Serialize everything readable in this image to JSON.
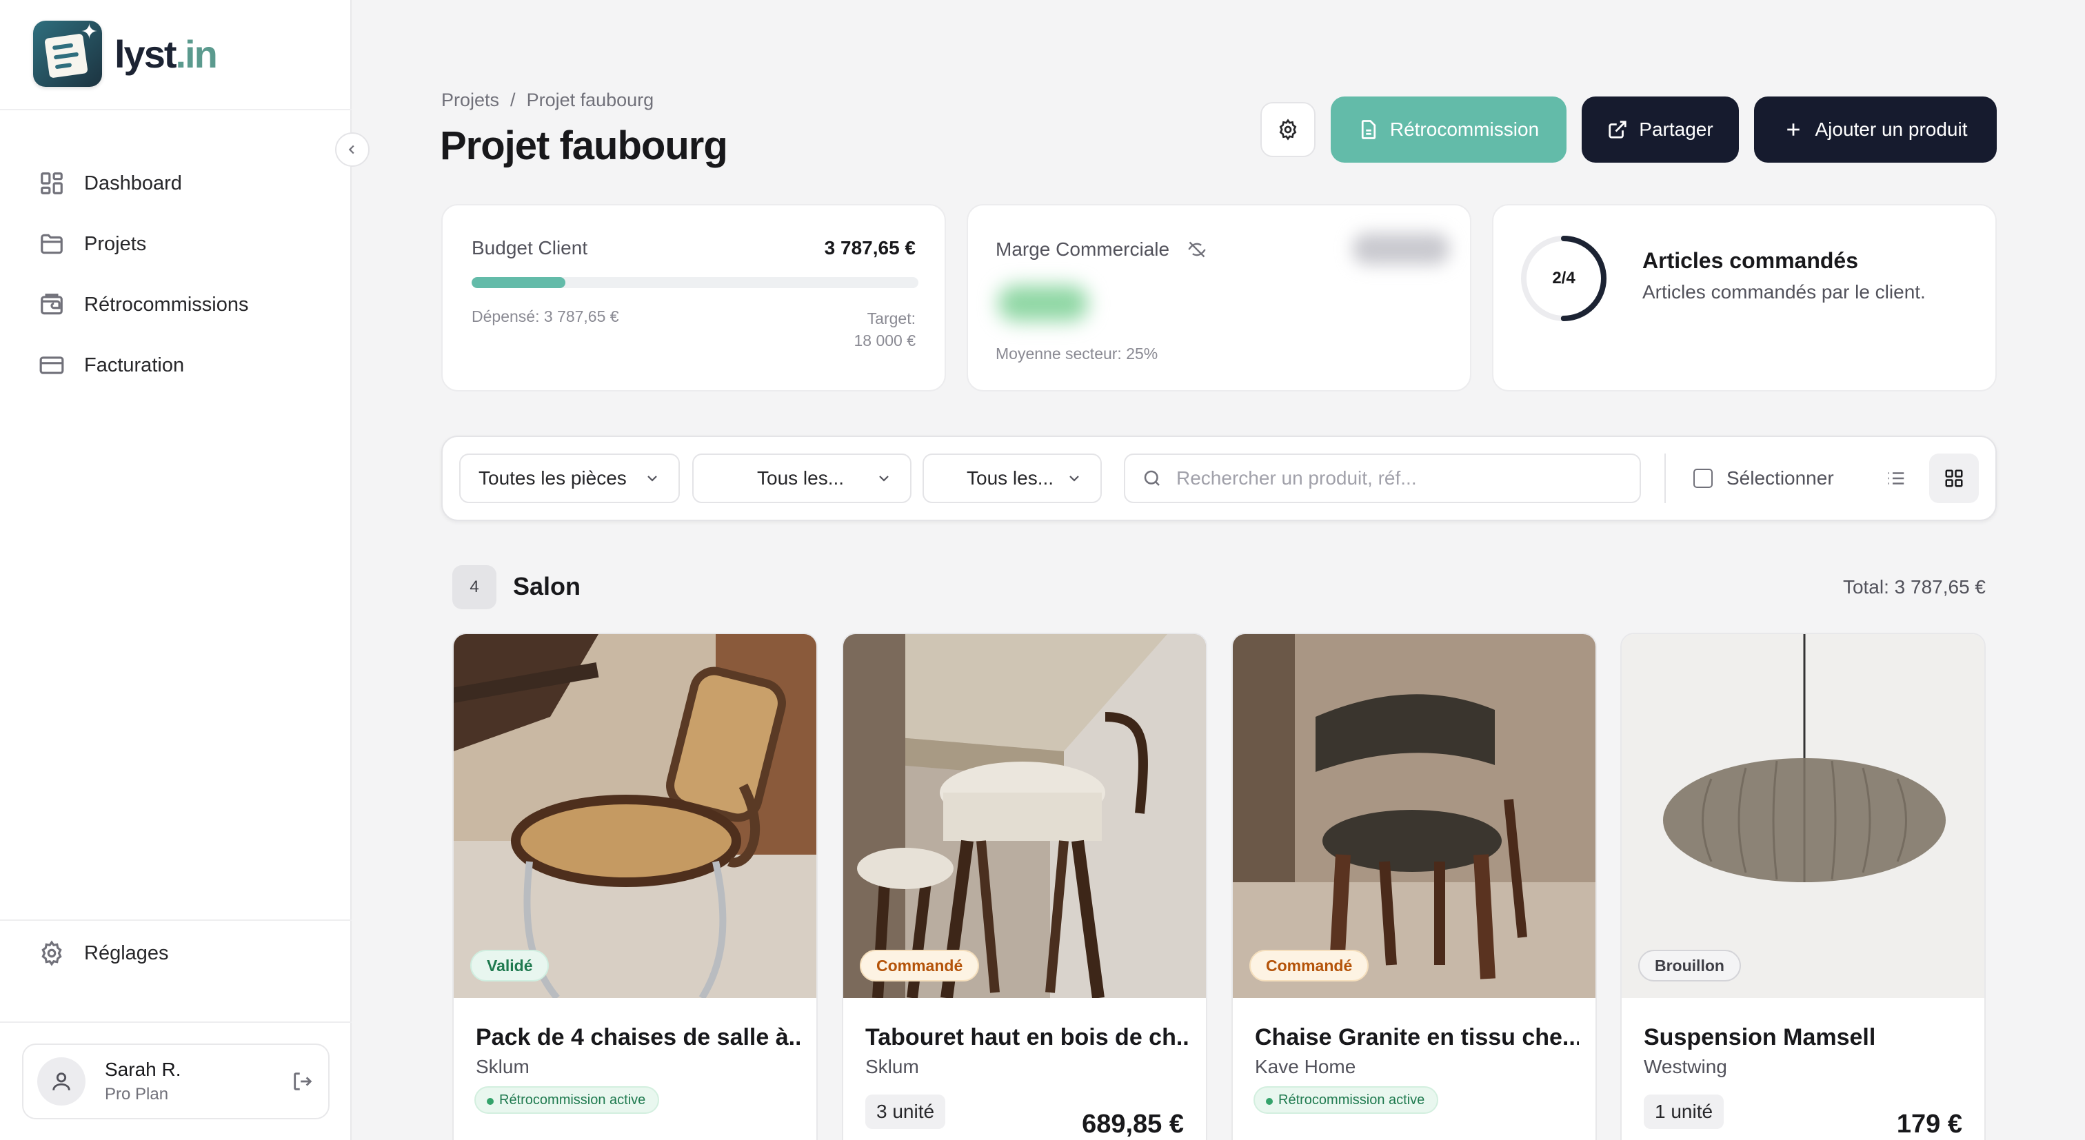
{
  "app": {
    "logo_text_main": "lyst",
    "logo_text_dot": ".in"
  },
  "sidebar": {
    "items": [
      {
        "label": "Dashboard",
        "icon": "dashboard-icon"
      },
      {
        "label": "Projets",
        "icon": "folder-icon"
      },
      {
        "label": "Rétrocommissions",
        "icon": "wallet-icon"
      },
      {
        "label": "Facturation",
        "icon": "credit-card-icon"
      }
    ],
    "settings_label": "Réglages",
    "user": {
      "name": "Sarah R.",
      "plan": "Pro Plan"
    }
  },
  "header": {
    "breadcrumb": [
      "Projets",
      "/",
      "Projet faubourg"
    ],
    "title": "Projet faubourg",
    "buttons": {
      "retro": "Rétrocommission",
      "share": "Partager",
      "add": "Ajouter un produit"
    }
  },
  "stats": {
    "budget": {
      "label": "Budget Client",
      "value": "3 787,65 €",
      "progress": 0.21,
      "spent": "Dépensé: 3 787,65 €",
      "target_label": "Target:",
      "target_value": "18 000 €"
    },
    "marge": {
      "label": "Marge Commerciale",
      "average": "Moyenne secteur: 25%"
    },
    "articles": {
      "ratio": "2/4",
      "fraction": 0.5,
      "title": "Articles commandés",
      "subtitle": "Articles commandés par le client."
    }
  },
  "filters": {
    "rooms": "Toutes les pièces",
    "filter2": "Tous les...",
    "filter3": "Tous les...",
    "search_placeholder": "Rechercher un produit, réf...",
    "select_label": "Sélectionner"
  },
  "section": {
    "count": "4",
    "title": "Salon",
    "total": "Total: 3 787,65 €"
  },
  "products": [
    {
      "status": "Validé",
      "title": "Pack de 4 chaises de salle à...",
      "brand": "Sklum",
      "retro": "Rétrocommission active"
    },
    {
      "status": "Commandé",
      "title": "Tabouret haut en bois de ch...",
      "brand": "Sklum",
      "qty": "3 unité",
      "price": "689,85 €"
    },
    {
      "status": "Commandé",
      "title": "Chaise Granite en tissu che...",
      "brand": "Kave Home",
      "retro": "Rétrocommission active"
    },
    {
      "status": "Brouillon",
      "title": "Suspension Mamsell",
      "brand": "Westwing",
      "qty": "1 unité",
      "price": "179 €"
    }
  ],
  "colors": {
    "accent": "#63bba9",
    "dark": "#161b2e",
    "valid": "#1f7a4f",
    "ordered": "#b45309"
  }
}
